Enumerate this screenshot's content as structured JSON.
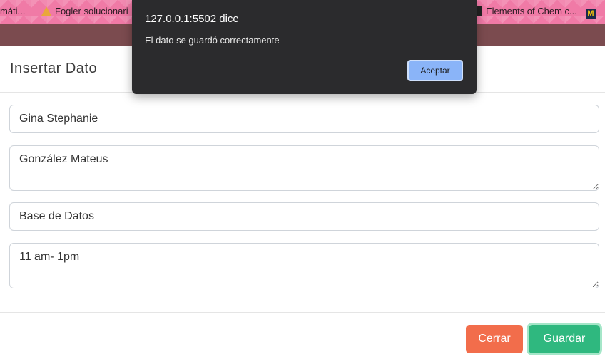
{
  "bookmarks": {
    "items": [
      {
        "label": "máti..."
      },
      {
        "label": "Fogler solucionari"
      },
      {
        "label": "Elements of Chem c..."
      }
    ]
  },
  "modal": {
    "title": "Insertar Dato",
    "fields": {
      "nombre": "Gina Stephanie",
      "apellido": "González Mateus",
      "materia": "Base de Datos",
      "horario": "11 am- 1pm"
    },
    "buttons": {
      "close": "Cerrar",
      "save": "Guardar"
    }
  },
  "alert": {
    "origin": "127.0.0.1:5502 dice",
    "message": "El dato se guardó correctamente",
    "ok": "Aceptar"
  }
}
